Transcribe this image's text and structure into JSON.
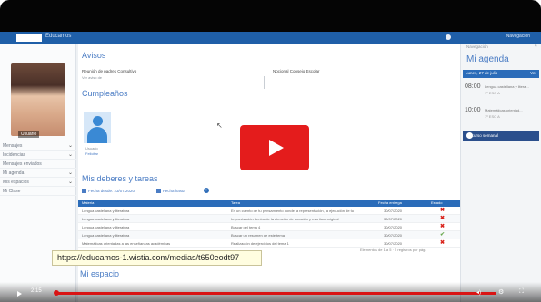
{
  "app": {
    "title": "Educamos",
    "topbar_right": "Navegación"
  },
  "sidebar": {
    "profile_name": "Usuario",
    "items": [
      {
        "label": "Mensajes",
        "chevron": "⌄"
      },
      {
        "label": "Incidencias",
        "chevron": "⌄"
      },
      {
        "label": "Mensajes enviados",
        "chevron": ""
      },
      {
        "label": "Mi agenda",
        "chevron": "⌄"
      },
      {
        "label": "Mis espacios",
        "chevron": "⌄"
      },
      {
        "label": "Mi Clase",
        "chevron": ""
      }
    ]
  },
  "main": {
    "avisos_title": "Avisos",
    "aviso_left": "Reunión de padres Consultivo",
    "aviso_left_sub": "Ver aviso de",
    "aviso_right": "Nocional Consejo Escolar",
    "cumpleanos_title": "Cumpleaños",
    "birthday_name": "Usuario",
    "birthday_sub": "Felicitar",
    "deberes_title": "Mis deberes y tareas",
    "filter_from": "Fecha desde: 23/07/2020",
    "filter_to": "Fecha hasta",
    "table_headers": [
      "Materia",
      "Tarea",
      "Fecha entrega",
      "Estado"
    ],
    "rows": [
      [
        "Lengua castellana y literatura",
        "En un cuento de tu pensamiento donde la representación, la ejecución de tu",
        "30/07/2020"
      ],
      [
        "Lengua castellana y literatura",
        "Improvisación dentro de la atención de creación y escritura original",
        "30/07/2020"
      ],
      [
        "Lengua castellana y literatura",
        "Buscar del tema 4",
        "30/07/2020"
      ],
      [
        "Lengua castellana y literatura",
        "Buscar un resumen de este tema",
        "30/07/2020"
      ],
      [
        "Matemáticas orientadas a las enseñanzas académicas",
        "Realización de ejercicios del tema 1",
        "30/07/2020"
      ]
    ],
    "pager": "Elementos de 1 a 5 · 5 registros por pág.",
    "url_tooltip": "https://educamos-1.wistia.com/medias/t650eodt97",
    "espacio_title": "Mi espacio"
  },
  "agenda": {
    "top_label": "Navegación",
    "title": "Mi agenda",
    "date_label": "Lunes, 27 de julio",
    "date_right": "Ver",
    "events": [
      {
        "time": "08:00",
        "desc": "Lengua castellana y litera...",
        "sub": "1º ESO A"
      },
      {
        "time": "10:00",
        "desc": "Matemáticas orientad...",
        "sub": "1º ESO A"
      }
    ],
    "recurso_label": "Recurso semanal"
  },
  "player": {
    "time": "2:15"
  },
  "colors": {
    "brand_blue": "#1f5fa8",
    "title_blue": "#4a7cc4",
    "play_red": "#e41c1c"
  }
}
